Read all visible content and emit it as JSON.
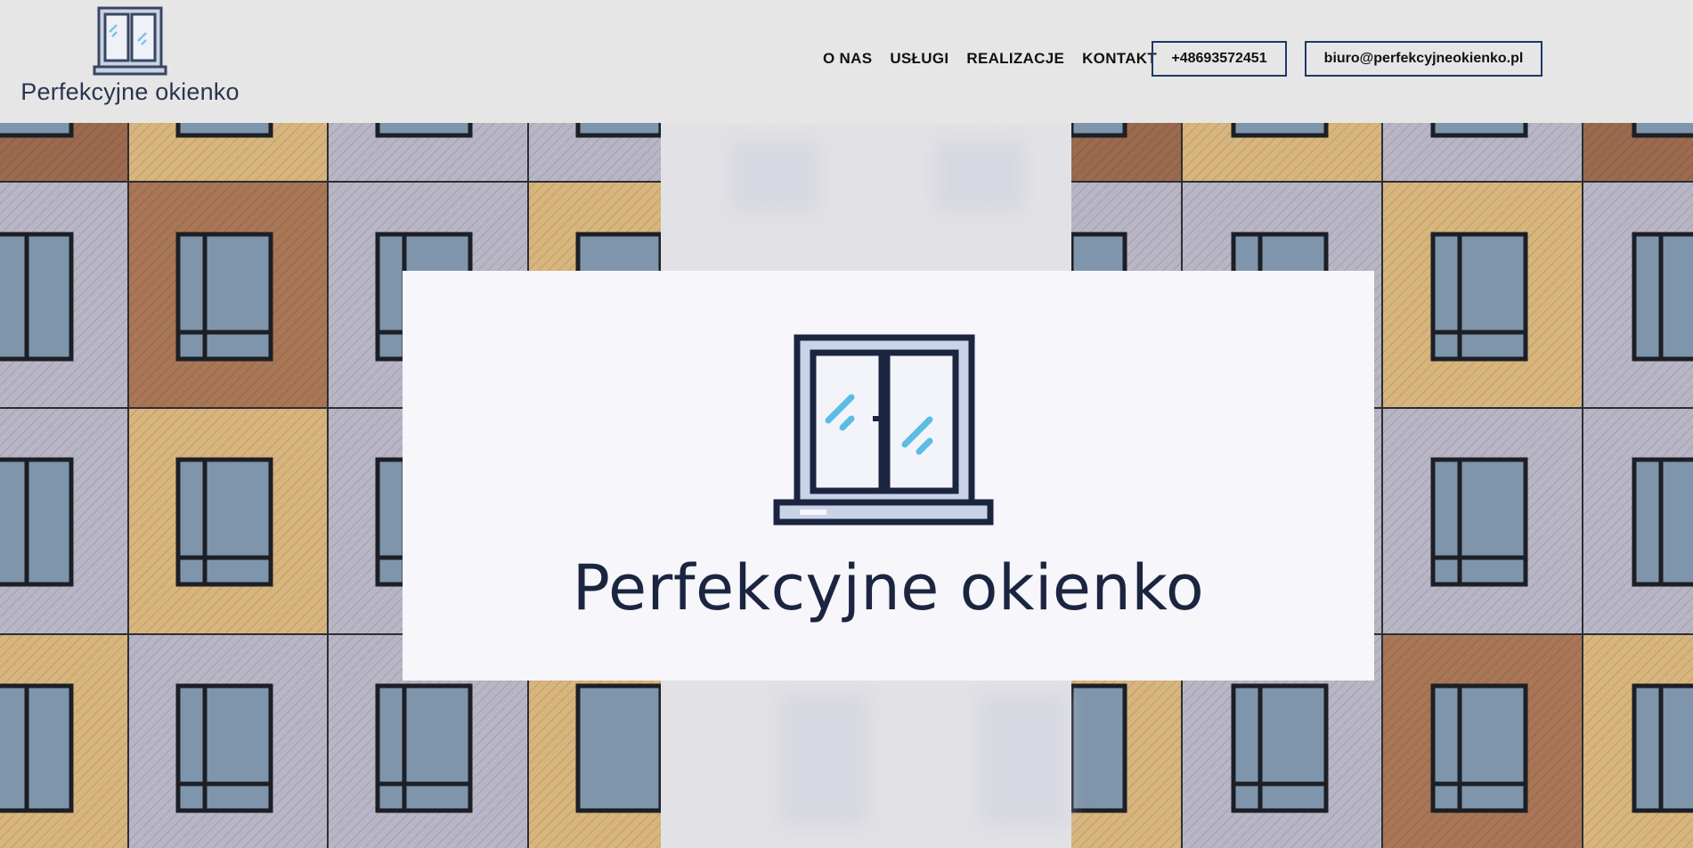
{
  "brand": {
    "name": "Perfekcyjne okienko",
    "logo_icon": "window-icon"
  },
  "nav": {
    "items": [
      "O NAS",
      "USŁUGI",
      "REALIZACJE",
      "KONTAKT"
    ]
  },
  "contact": {
    "phone": "+48693572451",
    "email": "biuro@perfekcyjneokienko.pl"
  },
  "hero": {
    "title": "Perfekcyjne okienko",
    "background": "building-facade-photo"
  },
  "colors": {
    "header_bg": "#e6e6e6",
    "brand_navy": "#1b2540",
    "button_border": "#1d3a66",
    "accent_blue": "#5bbce4"
  }
}
